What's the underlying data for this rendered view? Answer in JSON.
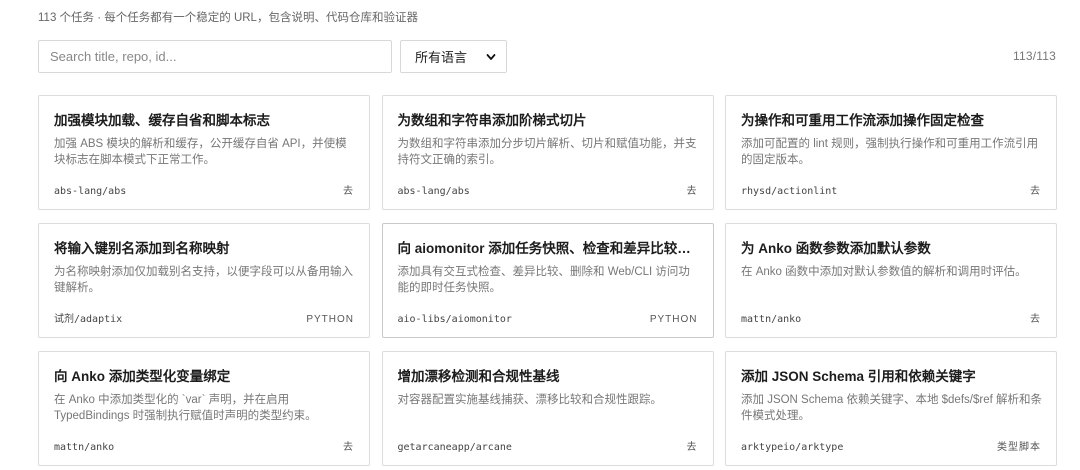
{
  "header": {
    "subtitle": "113 个任务 · 每个任务都有一个稳定的 URL，包含说明、代码仓库和验证器"
  },
  "search": {
    "placeholder": "Search title, repo, id...",
    "value": ""
  },
  "language_filter": {
    "selected": "所有语言",
    "icon": "chevron-down-icon"
  },
  "result_count": "113/113",
  "tasks": [
    {
      "title": "加强模块加载、缓存自省和脚本标志",
      "description": "加强 ABS 模块的解析和缓存，公开缓存自省 API，并使模块标志在脚本模式下正常工作。",
      "repo": "abs-lang/abs",
      "tag": "去"
    },
    {
      "title": "为数组和字符串添加阶梯式切片",
      "description": "为数组和字符串添加分步切片解析、切片和赋值功能，并支持符文正确的索引。",
      "repo": "abs-lang/abs",
      "tag": "去"
    },
    {
      "title": "为操作和可重用工作流添加操作固定检查",
      "description": "添加可配置的 lint 规则，强制执行操作和可重用工作流引用的固定版本。",
      "repo": "rhysd/actionlint",
      "tag": "去"
    },
    {
      "title": "将输入键别名添加到名称映射",
      "description": "为名称映射添加仅加载别名支持，以便字段可以从备用输入键解析。",
      "repo": "试剂/adaptix",
      "tag": "PYTHON"
    },
    {
      "title": "向 aiomonitor 添加任务快照、检查和差异比较功能",
      "description": "添加具有交互式检查、差异比较、删除和 Web/CLI 访问功能的即时任务快照。",
      "repo": "aio-libs/aiomonitor",
      "tag": "PYTHON"
    },
    {
      "title": "为 Anko 函数参数添加默认参数",
      "description": "在 Anko 函数中添加对默认参数值的解析和调用时评估。",
      "repo": "mattn/anko",
      "tag": "去"
    },
    {
      "title": "向 Anko 添加类型化变量绑定",
      "description": "在 Anko 中添加类型化的 `var` 声明，并在启用 TypedBindings 时强制执行赋值时声明的类型约束。",
      "repo": "mattn/anko",
      "tag": "去"
    },
    {
      "title": "增加漂移检测和合规性基线",
      "description": "对容器配置实施基线捕获、漂移比较和合规性跟踪。",
      "repo": "getarcaneapp/arcane",
      "tag": "去"
    },
    {
      "title": "添加 JSON Schema 引用和依赖关键字",
      "description": "添加 JSON Schema 依赖关键字、本地 $defs/$ref 解析和条件模式处理。",
      "repo": "arktypeio/arktype",
      "tag": "类型脚本"
    }
  ]
}
